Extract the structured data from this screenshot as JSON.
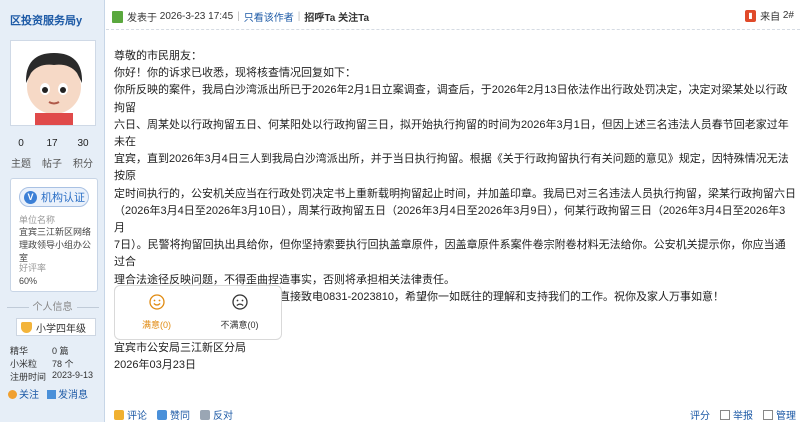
{
  "sidebar": {
    "username": "区投资服务局y",
    "stats": [
      {
        "value": "0",
        "label": "主题"
      },
      {
        "value": "17",
        "label": "帖子"
      },
      {
        "value": "30",
        "label": "积分"
      }
    ],
    "cert": {
      "button_label": "机构认证",
      "unit_label": "单位名称",
      "unit_value": "宜宾三江新区网络理政领导小组办公室",
      "rate_label": "好评率",
      "rate_value": "60%"
    },
    "personal_info_title": "个人信息",
    "level": "小学四年级",
    "info": [
      {
        "key": "精华",
        "value": "0 篇"
      },
      {
        "key": "小米粒",
        "value": "78 个"
      },
      {
        "key": "注册时间",
        "value": "2023-9-13"
      }
    ],
    "actions": {
      "follow": "关注",
      "message": "发消息"
    }
  },
  "header": {
    "posted_label": "发表于",
    "posted_time": "2026-3-23 17:45",
    "only_author": "只看该作者",
    "greet": "招呼Ta",
    "follow": "关注Ta",
    "source": "来自",
    "floor": "2#"
  },
  "content": {
    "salutation": "尊敬的市民朋友：",
    "lines": [
      "你好！你的诉求已收悉，现将核查情况回复如下：",
      "你所反映的案件，我局白沙湾派出所已于2026年2月1日立案调查，调查后，于2026年2月13日依法作出行政处罚决定，决定对梁某处以行政拘留",
      "六日、周某处以行政拘留五日、何某阳处以行政拘留三日，拟开始执行拘留的时间为2026年3月1日，但因上述三名违法人员春节回老家过年未在",
      "宜宾，直到2026年3月4日三人到我局白沙湾派出所，并于当日执行拘留。根据《关于行政拘留执行有关问题的意见》规定，因特殊情况无法按原",
      "定时间执行的，公安机关应当在行政处罚决定书上重新载明拘留起止时间，并加盖印章。我局已对三名违法人员执行拘留，梁某行政拘留六日",
      "（2026年3月4日至2026年3月10日），周某行政拘留五日（2026年3月4日至2026年3月9日），何某行政拘留三日（2026年3月4日至2026年3月",
      "7日）。民警将拘留回执出具给你，但你坚持索要执行回执盖章原件，因盖章原件系案件卷宗附卷材料无法给你。公安机关提示你，你应当通过合",
      "理合法途径反映问题，不得歪曲捏造事实，否则将承担相关法律责任。",
      "非常感谢你的来信，若有疑问，可直接致电0831-2023810，希望你一如既往的理解和支持我们的工作。祝你及家人万事如意！"
    ],
    "signature": "宜宾市公安局三江新区分局",
    "date": "2026年03月23日"
  },
  "vote": {
    "satisfied": "满意(0)",
    "unsatisfied": "不满意(0)"
  },
  "footer": {
    "comment": "评论",
    "like": "赞同",
    "dislike": "反对",
    "rate": "评分",
    "report": "举报",
    "manage": "管理"
  },
  "colors": {
    "link": "#1d5aa6",
    "sidebar_bg": "#e6eef7",
    "accent_orange": "#e08a10"
  }
}
